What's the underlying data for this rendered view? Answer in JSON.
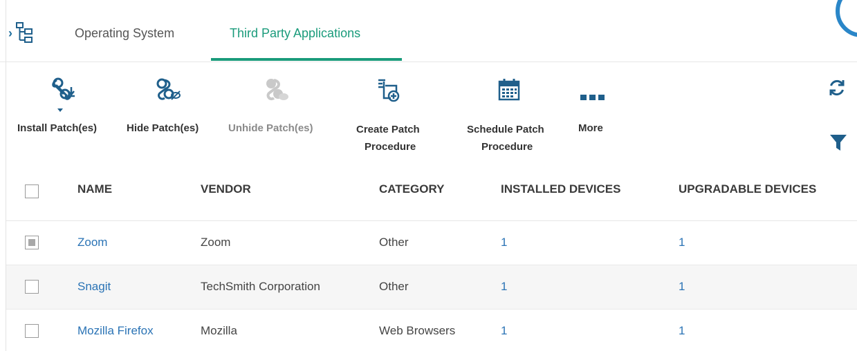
{
  "tabs": {
    "items": [
      {
        "label": "Operating System"
      },
      {
        "label": "Third Party Applications"
      }
    ],
    "active": "Third Party Applications"
  },
  "toolbar": {
    "install": {
      "label": "Install Patch(es)",
      "icon": "install-patch-icon"
    },
    "hide": {
      "label": "Hide Patch(es)",
      "icon": "hide-patch-icon"
    },
    "unhide": {
      "label": "Unhide Patch(es)",
      "icon": "unhide-patch-icon",
      "disabled": true
    },
    "create": {
      "label_line1": "Create Patch",
      "label_line2": "Procedure",
      "icon": "create-procedure-icon"
    },
    "schedule": {
      "label_line1": "Schedule Patch",
      "label_line2": "Procedure",
      "icon": "calendar-icon"
    },
    "more": {
      "label": "More",
      "icon": "more-dots-icon"
    },
    "refresh_icon": "refresh-icon",
    "filter_icon": "filter-icon"
  },
  "table": {
    "columns": [
      "NAME",
      "VENDOR",
      "CATEGORY",
      "INSTALLED DEVICES",
      "UPGRADABLE DEVICES"
    ],
    "rows": [
      {
        "name": "Zoom",
        "vendor": "Zoom",
        "category": "Other",
        "installed": "1",
        "upgradable": "1"
      },
      {
        "name": "Snagit",
        "vendor": "TechSmith Corporation",
        "category": "Other",
        "installed": "1",
        "upgradable": "1"
      },
      {
        "name": "Mozilla Firefox",
        "vendor": "Mozilla",
        "category": "Web Browsers",
        "installed": "1",
        "upgradable": "1"
      }
    ]
  },
  "colors": {
    "accent": "#1a9b7b",
    "link": "#2a73b5",
    "icon": "#1f5f8b"
  }
}
